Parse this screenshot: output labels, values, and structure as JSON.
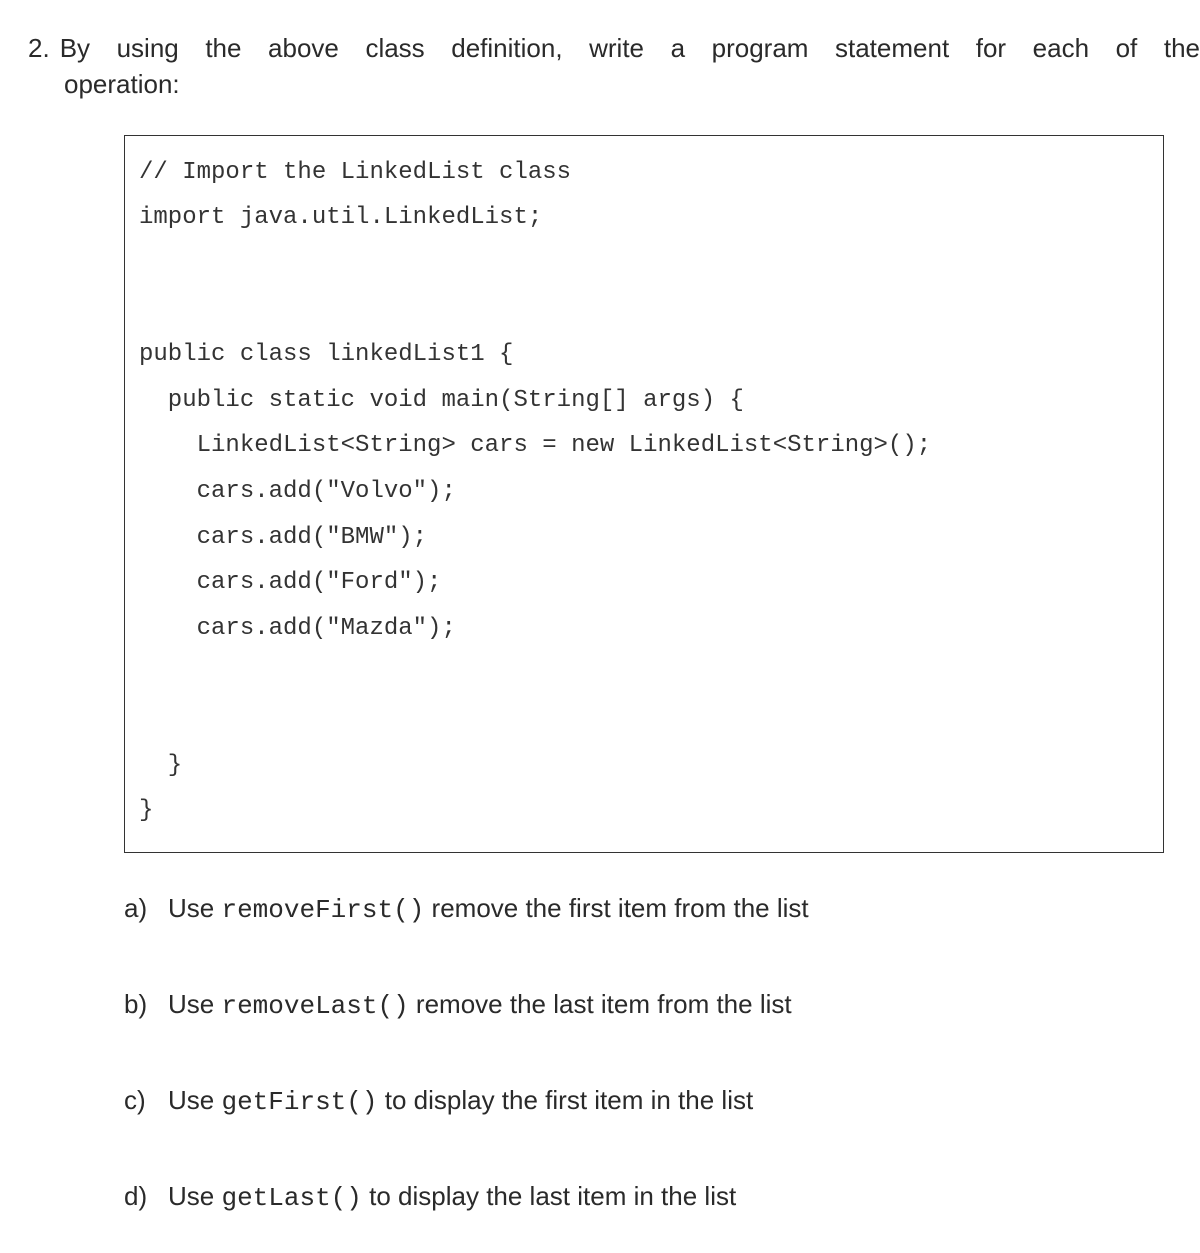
{
  "question": {
    "number": "2.",
    "text_line1": "By using the above class definition, write a program statement for each of the",
    "text_line2": "operation:"
  },
  "code": {
    "lines": [
      "// Import the LinkedList class",
      "import java.util.LinkedList;",
      "",
      "",
      "public class linkedList1 {",
      "  public static void main(String[] args) {",
      "    LinkedList<String> cars = new LinkedList<String>();",
      "    cars.add(\"Volvo\");",
      "    cars.add(\"BMW\");",
      "    cars.add(\"Ford\");",
      "    cars.add(\"Mazda\");",
      "",
      "",
      "  }",
      "}"
    ]
  },
  "subitems": [
    {
      "label": "a)",
      "prefix": "Use ",
      "code": "removeFirst()",
      "suffix": " remove the first item from the list"
    },
    {
      "label": "b)",
      "prefix": "Use ",
      "code": "removeLast()",
      "suffix": " remove the last item from the list"
    },
    {
      "label": "c)",
      "prefix": "Use ",
      "code": "getFirst()",
      "suffix": " to display the first item in the list"
    },
    {
      "label": "d)",
      "prefix": "Use ",
      "code": "getLast()",
      "suffix": " to display the last item in the list"
    }
  ]
}
